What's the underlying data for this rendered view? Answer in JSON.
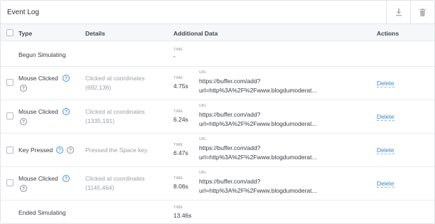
{
  "header": {
    "title": "Event Log",
    "download_icon": "download-icon",
    "trash_icon": "trash-icon"
  },
  "table": {
    "columns": {
      "type": "Type",
      "details": "Details",
      "additional": "Additional Data",
      "actions": "Actions"
    },
    "time_label": "TIME",
    "url_label": "URL",
    "delete_label": "Delete",
    "rows": [
      {
        "type": "Begun Simulating",
        "time": "-"
      },
      {
        "type": "Mouse Clicked",
        "details": [
          "Clicked at coordinates",
          "(692,136)"
        ],
        "time": "4.75s",
        "url": [
          "https://buffer.com/add?",
          "url=http%3A%2F%2Fwww.blogdumoderat..."
        ]
      },
      {
        "type": "Mouse Clicked",
        "details": [
          "Clicked at coordinates",
          "(1335,191)"
        ],
        "time": "6.24s",
        "url": [
          "https://buffer.com/add?",
          "url=http%3A%2F%2Fwww.blogdumoderat..."
        ]
      },
      {
        "type": "Key Pressed",
        "details": [
          "Pressed the Space key"
        ],
        "time": "6.47s",
        "url": [
          "https://buffer.com/add?",
          "url=http%3A%2F%2Fwww.blogdumoderat..."
        ]
      },
      {
        "type": "Mouse Clicked",
        "details": [
          "Clicked at coordinates",
          "(1145,464)"
        ],
        "time": "8.06s",
        "url": [
          "https://buffer.com/add?",
          "url=http%3A%2F%2Fwww.blogdumoderat..."
        ]
      },
      {
        "type": "Ended Simulating",
        "time": "13.46s"
      }
    ]
  },
  "colors": {
    "link": "#3b86cc",
    "help_icon": "#4a90d9",
    "header_bg": "#f6f7f9",
    "border": "#e1e4e8"
  }
}
